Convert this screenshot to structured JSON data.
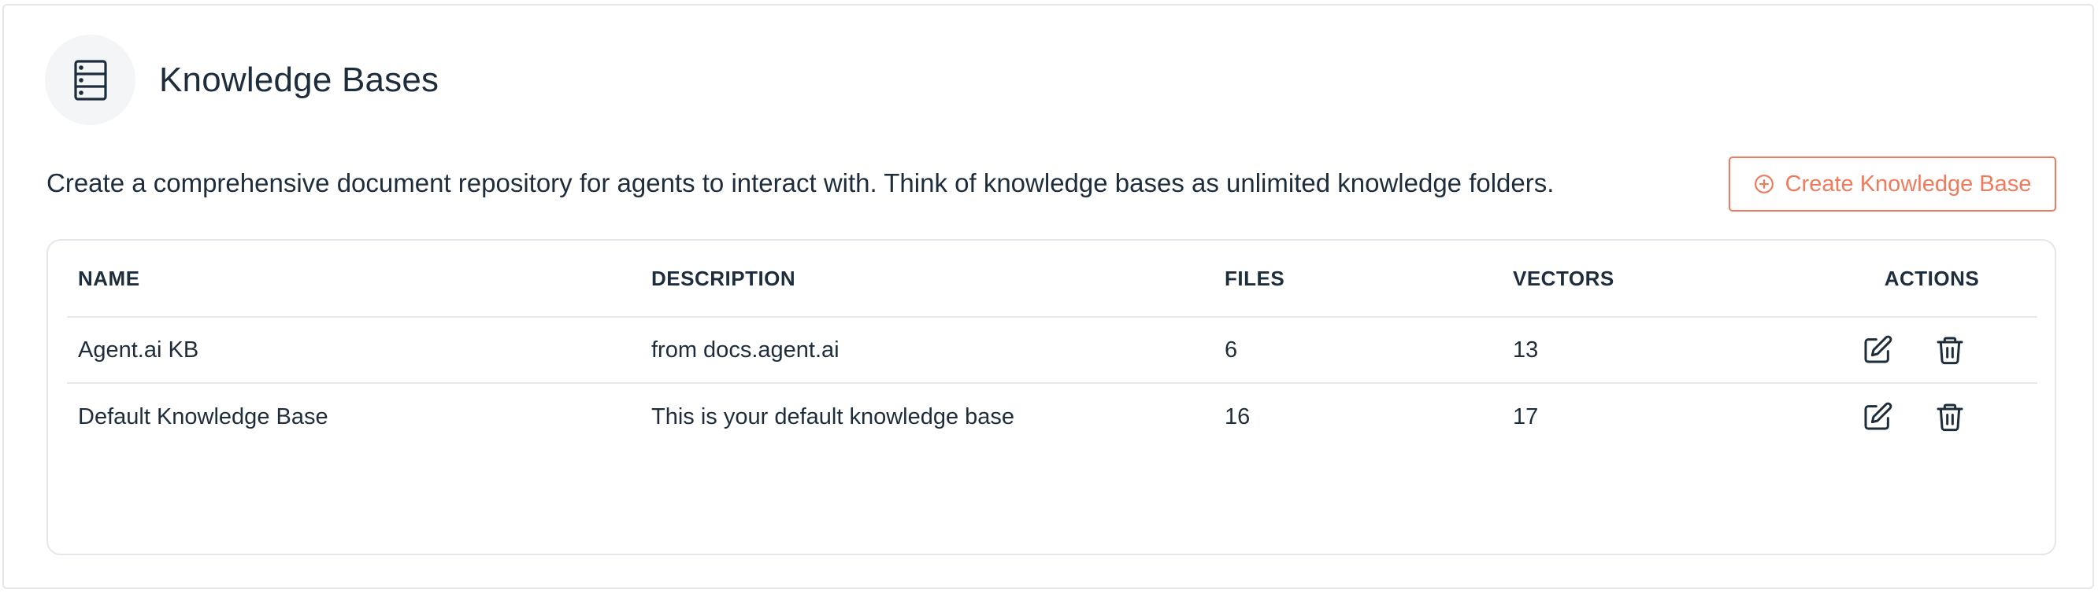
{
  "header": {
    "title": "Knowledge Bases",
    "icon": "server-stack-icon"
  },
  "subtitle": "Create a comprehensive document repository for agents to interact with. Think of knowledge bases as unlimited knowledge folders.",
  "create_button": {
    "label": "Create Knowledge Base",
    "icon": "plus-circle-icon"
  },
  "table": {
    "columns": {
      "name": "NAME",
      "description": "DESCRIPTION",
      "files": "FILES",
      "vectors": "VECTORS",
      "actions": "ACTIONS"
    },
    "rows": [
      {
        "name": "Agent.ai KB",
        "description": "from docs.agent.ai",
        "files": "6",
        "vectors": "13"
      },
      {
        "name": "Default Knowledge Base",
        "description": "This is your default knowledge base",
        "files": "16",
        "vectors": "17"
      }
    ],
    "row_actions": [
      "edit-icon",
      "trash-icon"
    ]
  },
  "colors": {
    "accent": "#f07a5c",
    "text": "#1e2d3b",
    "border": "#e3e7ec"
  }
}
